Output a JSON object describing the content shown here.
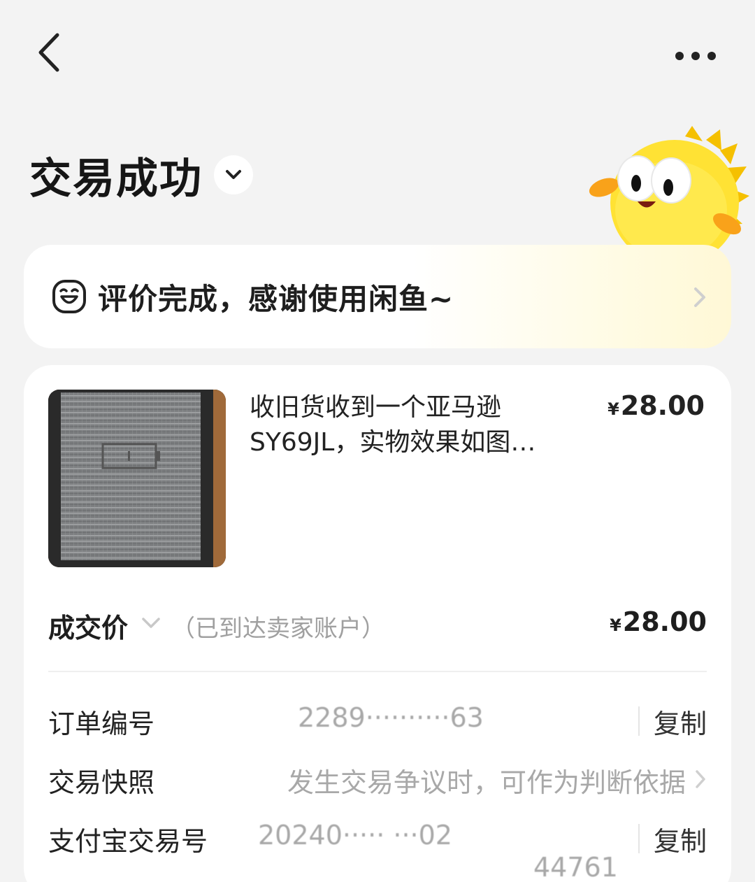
{
  "header": {
    "back_icon": "chevron-left-icon",
    "more_icon": "more-dots-icon"
  },
  "status": {
    "title": "交易成功",
    "toggle_icon": "chevron-down-icon"
  },
  "review_banner": {
    "text": "评价完成，感谢使用闲鱼~",
    "icon": "happy-face-icon"
  },
  "product": {
    "title_line1": "收旧货收到一个亚马逊",
    "title_line2": "SY69JL，实物效果如图…",
    "currency": "¥",
    "price": "28.00"
  },
  "deal": {
    "label": "成交价",
    "note": "（已到达卖家账户）",
    "currency": "¥",
    "price": "28.00"
  },
  "details": {
    "order_no_label": "订单编号",
    "order_no_value": "2289··········63",
    "snapshot_label": "交易快照",
    "snapshot_value": "发生交易争议时，可作为判断依据",
    "alipay_label": "支付宝交易号",
    "alipay_value_line1": "20240····· ···02",
    "alipay_value_line2": "44761",
    "copy_label": "复制"
  },
  "colors": {
    "background": "#f3f3f3",
    "card": "#ffffff",
    "accent_yellow": "#ffe34d",
    "muted_text": "#a8a8a8"
  }
}
